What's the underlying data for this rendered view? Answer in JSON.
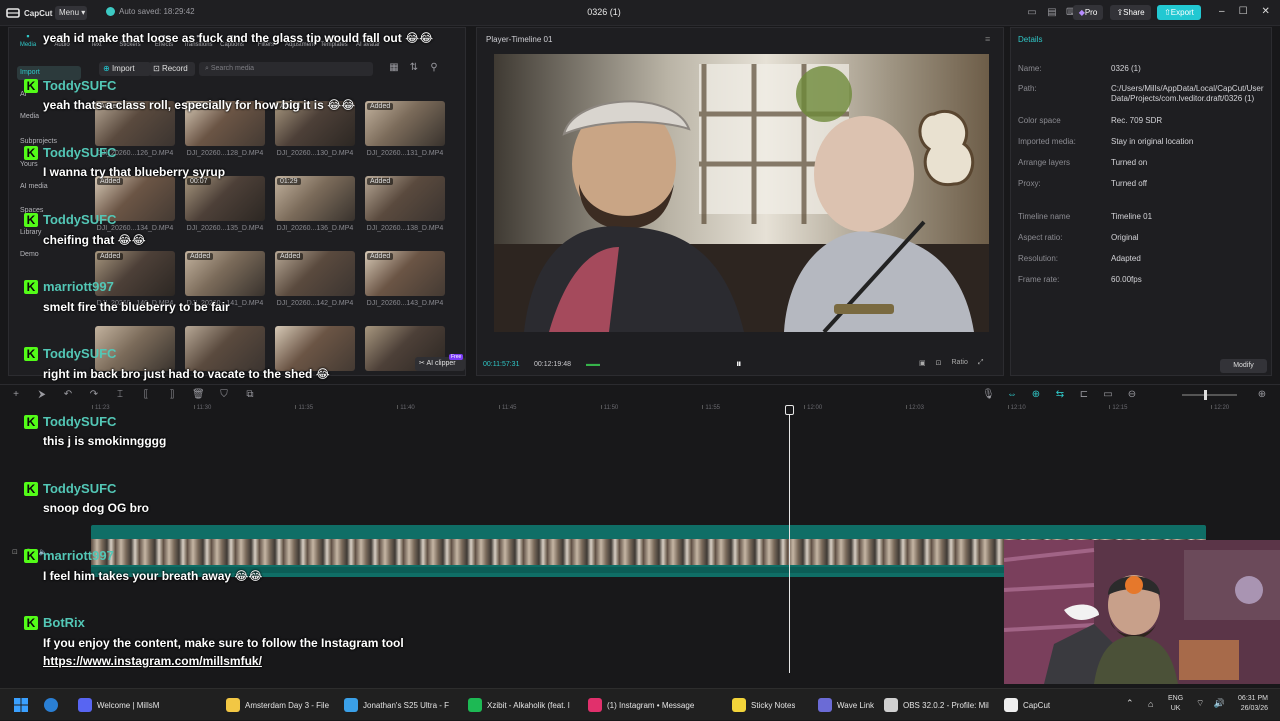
{
  "window": {
    "app_name": "CapCut",
    "menu_label": "Menu",
    "autosave": "Auto saved: 18:29:42",
    "project_title": "0326 (1)",
    "pro_label": "Pro",
    "share_label": "Share",
    "export_label": "Export"
  },
  "toolbar_tabs": [
    {
      "label": "Media",
      "icon": "media-icon"
    },
    {
      "label": "Audio",
      "icon": "audio-icon"
    },
    {
      "label": "Text",
      "icon": "text-icon"
    },
    {
      "label": "Stickers",
      "icon": "stickers-icon"
    },
    {
      "label": "Effects",
      "icon": "effects-icon"
    },
    {
      "label": "Transitions",
      "icon": "transitions-icon"
    },
    {
      "label": "Captions",
      "icon": "captions-icon"
    },
    {
      "label": "Filters",
      "icon": "filters-icon"
    },
    {
      "label": "Adjustment",
      "icon": "adjustment-icon"
    },
    {
      "label": "Templates",
      "icon": "templates-icon"
    },
    {
      "label": "AI avatar",
      "icon": "ai-avatar-icon"
    }
  ],
  "media_sidebar": {
    "items": [
      "Import",
      "AI",
      "Media",
      "Subprojects",
      "Yours",
      "AI media",
      "Spaces",
      "Library",
      "Demo"
    ]
  },
  "media_bar": {
    "import_label": "Import",
    "record_label": "Record",
    "search_placeholder": "Search media"
  },
  "media_grid": {
    "rows": [
      [
        {
          "name": "DJI_20260...126_D.MP4",
          "badge": "Added"
        },
        {
          "name": "DJI_20260...128_D.MP4",
          "badge": "Added"
        },
        {
          "name": "DJI_20260...130_D.MP4",
          "badge": "Added"
        },
        {
          "name": "DJI_20260...131_D.MP4",
          "badge": "Added"
        }
      ],
      [
        {
          "name": "DJI_20260...134_D.MP4",
          "badge": "Added"
        },
        {
          "name": "DJI_20260...135_D.MP4",
          "badge": "00:07"
        },
        {
          "name": "DJI_20260...136_D.MP4",
          "badge": "01:29"
        },
        {
          "name": "DJI_20260...138_D.MP4",
          "badge": "Added"
        }
      ],
      [
        {
          "name": "DJI_20260...140_D.MP4",
          "badge": "Added"
        },
        {
          "name": "DJI_20260...141_D.MP4",
          "badge": "Added"
        },
        {
          "name": "DJI_20260...142_D.MP4",
          "badge": "Added"
        },
        {
          "name": "DJI_20260...143_D.MP4",
          "badge": "Added"
        }
      ],
      [
        {
          "name": "",
          "badge": ""
        },
        {
          "name": "",
          "badge": ""
        },
        {
          "name": "",
          "badge": ""
        },
        {
          "name": "",
          "badge": ""
        }
      ]
    ],
    "ai_clipper_label": "AI clipper",
    "ai_clipper_badge": "Free"
  },
  "player": {
    "title": "Player-Timeline 01",
    "current_time": "00:11:57:31",
    "total_time": "00:12:19:48",
    "ratio_label": "Ratio"
  },
  "details": {
    "title": "Details",
    "rows": [
      {
        "label": "Name:",
        "value": "0326 (1)"
      },
      {
        "label": "Path:",
        "value": "C:/Users/Mills/AppData/Local/CapCut/User Data/Projects/com.lveditor.draft/0326 (1)"
      },
      {
        "label": "Color space",
        "value": "Rec. 709 SDR"
      },
      {
        "label": "Imported media:",
        "value": "Stay in original location"
      },
      {
        "label": "Arrange layers",
        "value": "Turned on"
      },
      {
        "label": "Proxy:",
        "value": "Turned off"
      },
      {
        "label": "Timeline name",
        "value": "Timeline 01"
      },
      {
        "label": "Aspect ratio:",
        "value": "Original"
      },
      {
        "label": "Resolution:",
        "value": "Adapted"
      },
      {
        "label": "Frame rate:",
        "value": "60.00fps"
      }
    ],
    "modify_label": "Modify"
  },
  "timeline": {
    "ruler_labels": [
      "11:23",
      "11:30",
      "11:35",
      "11:40",
      "11:45",
      "11:50",
      "11:55",
      "12:00",
      "12:03",
      "12:10",
      "12:15",
      "12:20"
    ],
    "playhead_fraction": 0.596,
    "track_end_fraction": 0.953
  },
  "chat": [
    {
      "user": "",
      "message": "yeah id make that loose as fuck and the glass tip would fall out 😂😂"
    },
    {
      "user": "ToddySUFC",
      "message": "yeah thats a class roll, especially for how big it is 😂😂"
    },
    {
      "user": "ToddySUFC",
      "message": "I wanna try that blueberry syrup"
    },
    {
      "user": "ToddySUFC",
      "message": "cheifing that 😂😂"
    },
    {
      "user": "marriott997",
      "message": "smelt fire the blueberry to be fair"
    },
    {
      "user": "ToddySUFC",
      "message": "right im back bro just had to vacate to the shed 😂"
    },
    {
      "user": "ToddySUFC",
      "message": "this j is smokinngggg"
    },
    {
      "user": "ToddySUFC",
      "message": "snoop dog OG bro"
    },
    {
      "user": "marriott997",
      "message": "I feel him takes your breath away 😂😂"
    },
    {
      "user": "BotRix",
      "message": "If you enjoy the content, make sure to follow the Instagram tool",
      "link": "https://www.instagram.com/millsmfuk/"
    }
  ],
  "taskbar": {
    "items": [
      {
        "label": "Welcome | MillsM",
        "color": "#5865f2"
      },
      {
        "label": "Amsterdam Day 3 - File",
        "color": "#f2c744"
      },
      {
        "label": "Jonathan's S25 Ultra - F",
        "color": "#3aa0e8"
      },
      {
        "label": "Xzibit - Alkaholik (feat. l",
        "color": "#1db954"
      },
      {
        "label": "(1) Instagram • Message",
        "color": "#e1306c"
      },
      {
        "label": "Sticky Notes",
        "color": "#f2d43a"
      },
      {
        "label": "Wave Link",
        "color": "#6b6bd6"
      },
      {
        "label": "OBS 32.0.2 - Profile: Mil",
        "color": "#d0d0d0"
      },
      {
        "label": "CapCut",
        "color": "#eeeeee"
      }
    ],
    "lang_line1": "ENG",
    "lang_line2": "UK",
    "clock_time": "06:31 PM",
    "clock_date": "26/03/26"
  },
  "colors": {
    "accent": "#21c7c7",
    "kick_green": "#53fc18",
    "export": "#22c8d2"
  }
}
